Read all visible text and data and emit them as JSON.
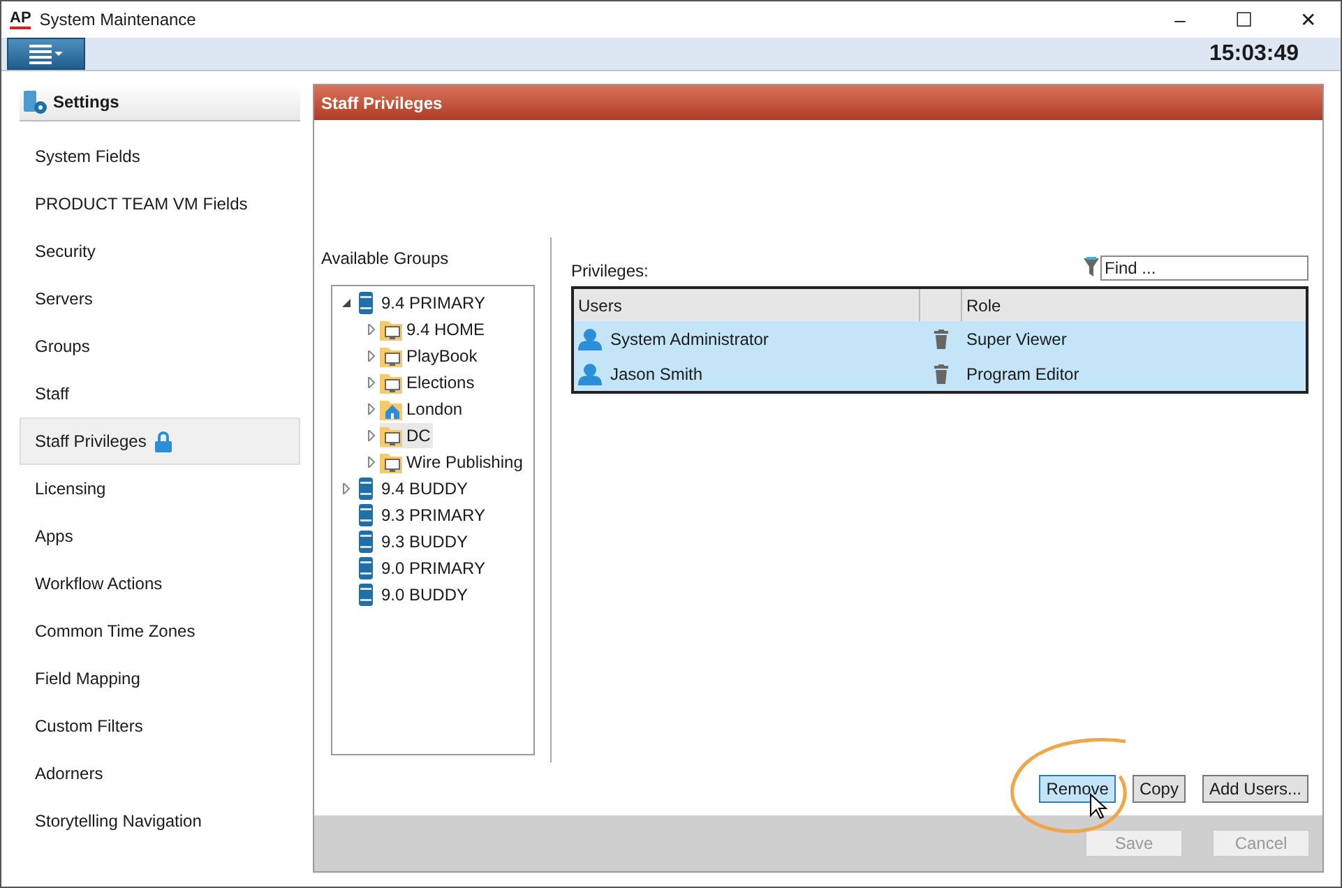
{
  "window": {
    "logo": "AP",
    "title": "System Maintenance",
    "controls": [
      "–",
      "☐",
      "✕"
    ]
  },
  "toolbar": {
    "clock": "15:03:49"
  },
  "sidebar": {
    "title": "Settings",
    "items": [
      {
        "label": "System Fields",
        "selected": false,
        "locked": false
      },
      {
        "label": "PRODUCT TEAM VM Fields",
        "selected": false,
        "locked": false
      },
      {
        "label": "Security",
        "selected": false,
        "locked": false
      },
      {
        "label": "Servers",
        "selected": false,
        "locked": false
      },
      {
        "label": "Groups",
        "selected": false,
        "locked": false
      },
      {
        "label": "Staff",
        "selected": false,
        "locked": false
      },
      {
        "label": "Staff Privileges",
        "selected": true,
        "locked": true
      },
      {
        "label": "Licensing",
        "selected": false,
        "locked": false
      },
      {
        "label": "Apps",
        "selected": false,
        "locked": false
      },
      {
        "label": "Workflow Actions",
        "selected": false,
        "locked": false
      },
      {
        "label": "Common Time Zones",
        "selected": false,
        "locked": false
      },
      {
        "label": "Field Mapping",
        "selected": false,
        "locked": false
      },
      {
        "label": "Custom Filters",
        "selected": false,
        "locked": false
      },
      {
        "label": "Adorners",
        "selected": false,
        "locked": false
      },
      {
        "label": "Storytelling Navigation",
        "selected": false,
        "locked": false
      }
    ]
  },
  "panel": {
    "title": "Staff Privileges",
    "groups": {
      "label": "Available Groups",
      "tree": [
        {
          "label": "9.4 PRIMARY",
          "kind": "server",
          "expanded": true,
          "selected": false,
          "children": [
            {
              "label": "9.4 HOME",
              "kind": "folder",
              "expanded": false,
              "selected": false
            },
            {
              "label": "PlayBook",
              "kind": "folder",
              "expanded": false,
              "selected": false
            },
            {
              "label": "Elections",
              "kind": "folder",
              "expanded": false,
              "selected": false
            },
            {
              "label": "London",
              "kind": "home",
              "expanded": false,
              "selected": false
            },
            {
              "label": "DC",
              "kind": "folder",
              "expanded": false,
              "selected": true
            },
            {
              "label": "Wire Publishing",
              "kind": "folder",
              "expanded": false,
              "selected": false
            }
          ]
        },
        {
          "label": "9.4 BUDDY",
          "kind": "server",
          "expanded": false,
          "selected": false
        },
        {
          "label": "9.3 PRIMARY",
          "kind": "server",
          "selected": false
        },
        {
          "label": "9.3 BUDDY",
          "kind": "server",
          "selected": false
        },
        {
          "label": "9.0 PRIMARY",
          "kind": "server",
          "selected": false
        },
        {
          "label": "9.0 BUDDY",
          "kind": "server",
          "selected": false
        }
      ]
    },
    "privileges": {
      "label": "Privileges:",
      "find": {
        "placeholder": "Find ..."
      },
      "columns": [
        "Users",
        "Role"
      ],
      "rows": [
        {
          "user": "System Administrator",
          "role": "Super Viewer",
          "selected": true
        },
        {
          "user": "Jason Smith",
          "role": "Program Editor",
          "selected": true
        }
      ]
    },
    "buttons": [
      {
        "label": "Remove",
        "hovered": true
      },
      {
        "label": "Copy",
        "hovered": false
      },
      {
        "label": "Add Users...",
        "hovered": false
      }
    ],
    "footer_buttons": [
      {
        "label": "Save",
        "disabled": true
      },
      {
        "label": "Cancel",
        "disabled": true
      }
    ]
  }
}
